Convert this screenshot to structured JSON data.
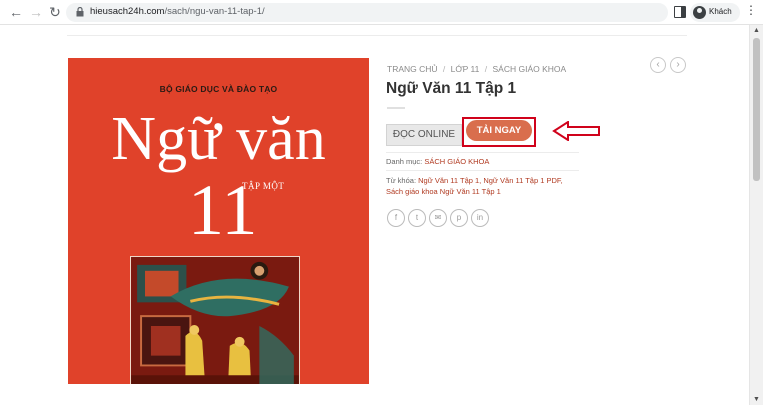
{
  "browser": {
    "back": "←",
    "forward": "→",
    "reload": "↻",
    "url_domain": "hieusach24h.com",
    "url_path": "/sach/ngu-van-11-tap-1/",
    "profile_name": "Khách",
    "menu": "⋮"
  },
  "cover": {
    "ministry": "BỘ GIÁO DỤC VÀ ĐÀO TẠO",
    "title": "Ngữ văn",
    "grade": "11",
    "volume": "TẬP MỘT"
  },
  "product": {
    "breadcrumb": [
      "Trang chủ",
      "/",
      "Lớp 11",
      "/",
      "Sách giáo khoa"
    ],
    "title": "Ngữ Văn 11 Tập 1",
    "prev_icon": "‹",
    "next_icon": "›",
    "read_online_label": "Đọc Online",
    "download_label": "Tải ngay",
    "category_label": "Danh mục:",
    "category_value": "Sách giáo khoa",
    "tags_label": "Từ khóa:",
    "tags_value": "Ngữ Văn 11 Tập 1, Ngữ Văn 11 Tập 1 PDF, Sách giáo khoa Ngữ Văn 11 Tập 1"
  },
  "share": {
    "icons": [
      "facebook-icon",
      "twitter-icon",
      "email-icon",
      "pinterest-icon",
      "linkedin-icon"
    ],
    "glyphs": [
      "f",
      "t",
      "✉",
      "p",
      "in"
    ]
  },
  "colors": {
    "accent": "#d96e4d",
    "highlight": "#d0021b",
    "cover_red": "#e0422a",
    "link": "#b13b22"
  }
}
